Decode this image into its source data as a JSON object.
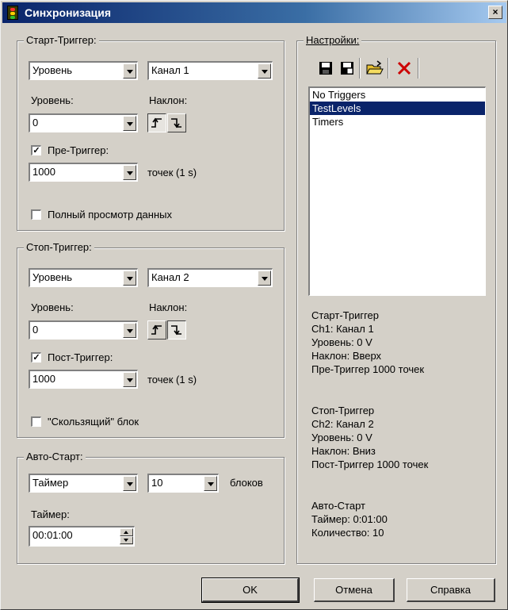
{
  "window": {
    "title": "Синхронизация",
    "close_glyph": "×"
  },
  "start_trigger": {
    "group_label": "Старт-Триггер:",
    "mode": "Уровень",
    "channel": "Канал 1",
    "level_label": "Уровень:",
    "level_value": "0",
    "slope_label": "Наклон:",
    "slope_selected": "up",
    "pre_trigger_checked": true,
    "pre_trigger_label": "Пре-Триггер:",
    "points_value": "1000",
    "points_unit": "точек (1 s)",
    "full_view_checked": false,
    "full_view_label": "Полный просмотр данных"
  },
  "stop_trigger": {
    "group_label": "Стоп-Триггер:",
    "mode": "Уровень",
    "channel": "Канал 2",
    "level_label": "Уровень:",
    "level_value": "0",
    "slope_label": "Наклон:",
    "slope_selected": "down",
    "post_trigger_checked": true,
    "post_trigger_label": "Пост-Триггер:",
    "points_value": "1000",
    "points_unit": "точек (1 s)",
    "sliding_checked": false,
    "sliding_label": "\"Скользящий\" блок"
  },
  "auto_start": {
    "group_label": "Авто-Старт:",
    "mode": "Таймер",
    "blocks_value": "10",
    "blocks_label": "блоков",
    "timer_label": "Таймер:",
    "timer_value": "00:01:00"
  },
  "settings": {
    "group_label": "Настройки:",
    "toolbar_icons": [
      "save-icon",
      "save-as-icon",
      "open-folder-icon",
      "delete-icon"
    ],
    "items": [
      "No Triggers",
      "TestLevels",
      "Timers"
    ],
    "selected_index": 1,
    "summary": [
      "Старт-Триггер",
      "Ch1: Канал 1",
      "Уровень:  0 V",
      "Наклон: Вверх",
      "Пре-Триггер 1000 точек",
      "Стоп-Триггер",
      "Ch2: Канал 2",
      "Уровень:  0 V",
      "Наклон: Вниз",
      "Пост-Триггер 1000 точек",
      "Авто-Старт",
      "Таймер: 0:01:00",
      "Количество: 10"
    ]
  },
  "buttons": {
    "ok": "OK",
    "cancel": "Отмена",
    "help": "Справка"
  },
  "colors": {
    "title_bar": "#0a246a",
    "selection": "#0a246a",
    "face": "#d4d0c8",
    "delete_icon": "#cc0000"
  }
}
